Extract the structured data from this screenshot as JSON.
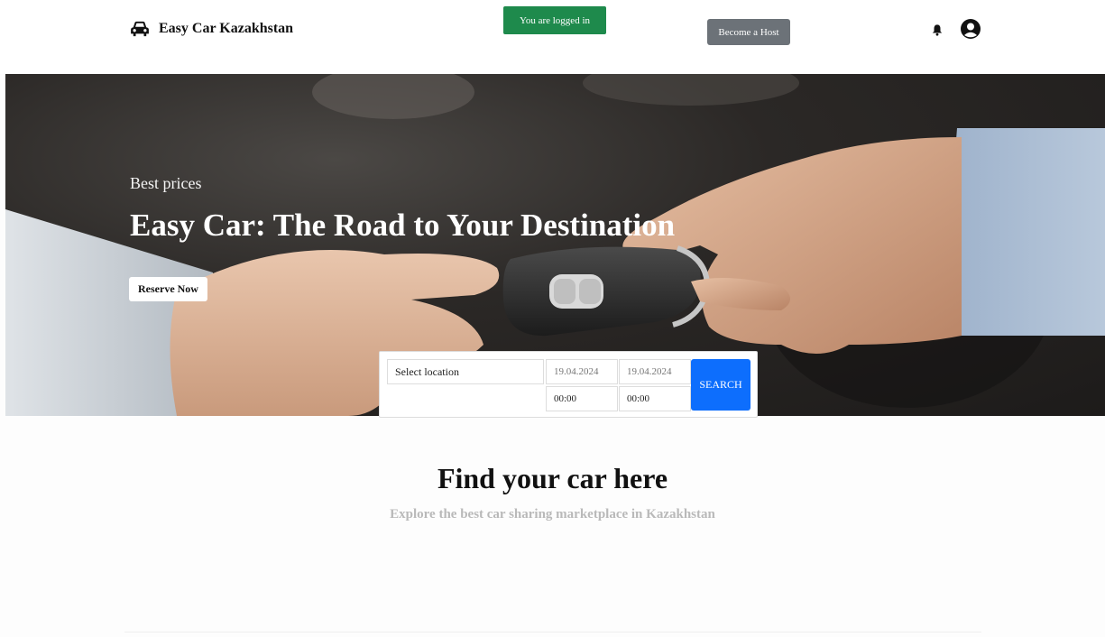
{
  "header": {
    "brand": "Easy Car Kazakhstan",
    "brand_icon": "car-icon",
    "logged_badge": "You are logged in",
    "host_button": "Become a Host",
    "notification_icon": "bell-icon",
    "account_icon": "user-circle-icon"
  },
  "hero": {
    "subtitle": "Best prices",
    "title": "Easy Car: The Road to Your Destination",
    "reserve_button": "Reserve Now"
  },
  "search": {
    "location_value": "Select location",
    "pickup_date_placeholder": "19.04.2024",
    "return_date_placeholder": "19.04.2024",
    "pickup_time_value": "00:00",
    "return_time_value": "00:00",
    "search_button": "SEARCH"
  },
  "section": {
    "title": "Find your car here",
    "subtitle": "Explore the best car sharing marketplace in Kazakhstan"
  },
  "colors": {
    "logged_badge": "#1e8a4c",
    "host_button": "#6c7278",
    "search_button": "#0d6efd"
  }
}
